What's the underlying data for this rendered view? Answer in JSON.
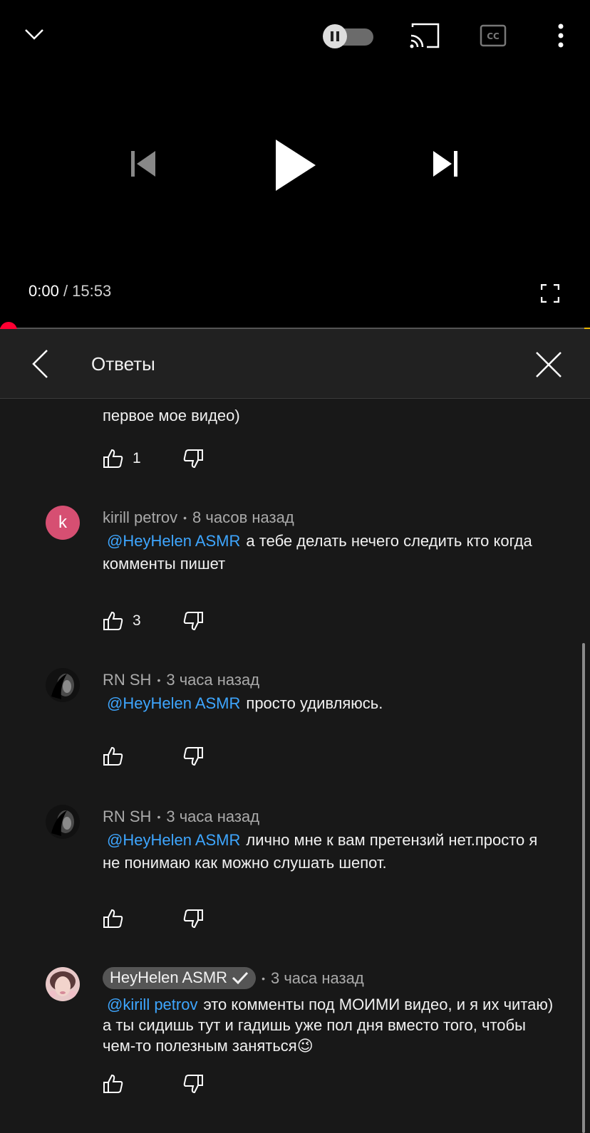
{
  "player": {
    "current_time": "0:00",
    "duration": "/ 15:53",
    "progress_fraction": 0.0,
    "icons": [
      "collapse-icon",
      "autoplay-toggle",
      "cast-icon",
      "captions-icon",
      "more-icon",
      "previous-icon",
      "play-icon",
      "next-icon",
      "fullscreen-icon"
    ]
  },
  "panel": {
    "title": "Ответы"
  },
  "cut_text": "первое мое видео)",
  "cut_likes": "1",
  "replies": [
    {
      "author": "kirill petrov",
      "time": "8 часов назад",
      "mention": "@HeyHelen ASMR",
      "text": "а тебе делать нечего следить кто когда комменты пишет",
      "likes": "3",
      "avatar_letter": "k"
    },
    {
      "author": "RN SH",
      "time": "3 часа назад",
      "mention": "@HeyHelen ASMR",
      "text": "просто удивляюсь.",
      "likes": ""
    },
    {
      "author": "RN SH",
      "time": "3 часа назад",
      "mention": "@HeyHelen ASMR",
      "text": "лично мне к вам претензий нет.просто я не понимаю как можно слушать шепот.",
      "likes": ""
    },
    {
      "author": "HeyHelen ASMR",
      "time": "3 часа назад",
      "mention": "@kirill petrov",
      "text": "это комменты под МОИМИ видео, и я их читаю) а ты сидишь тут и гадишь уже пол дня вместо того, чтобы чем-то полезным заняться😉",
      "likes": ""
    }
  ],
  "separator": "•"
}
